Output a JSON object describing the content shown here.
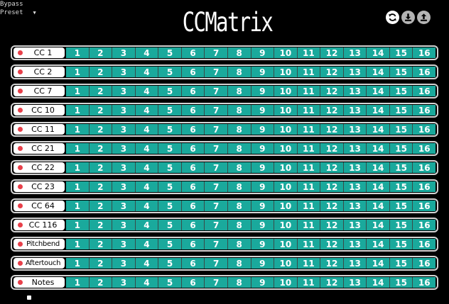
{
  "host": {
    "bypass_label": "Bypass",
    "preset_label": "Preset",
    "preset_caret": "▼"
  },
  "app": {
    "title": "CCMatrix"
  },
  "toolbar": {
    "icons": [
      "refresh-icon",
      "download-icon",
      "upload-icon"
    ]
  },
  "colors": {
    "accent": "#1aa99c",
    "dot": "#e8404a",
    "background": "#000000"
  },
  "matrix": {
    "channels": [
      "1",
      "2",
      "3",
      "4",
      "5",
      "6",
      "7",
      "8",
      "9",
      "10",
      "11",
      "12",
      "13",
      "14",
      "15",
      "16"
    ],
    "rows": [
      {
        "label": "CC 1"
      },
      {
        "label": "CC 2"
      },
      {
        "label": "CC 7"
      },
      {
        "label": "CC 10"
      },
      {
        "label": "CC 11"
      },
      {
        "label": "CC 21"
      },
      {
        "label": "CC 22"
      },
      {
        "label": "CC 23"
      },
      {
        "label": "CC 64"
      },
      {
        "label": "CC 116"
      },
      {
        "label": "Pitchbend"
      },
      {
        "label": "Aftertouch"
      },
      {
        "label": "Notes"
      }
    ]
  }
}
